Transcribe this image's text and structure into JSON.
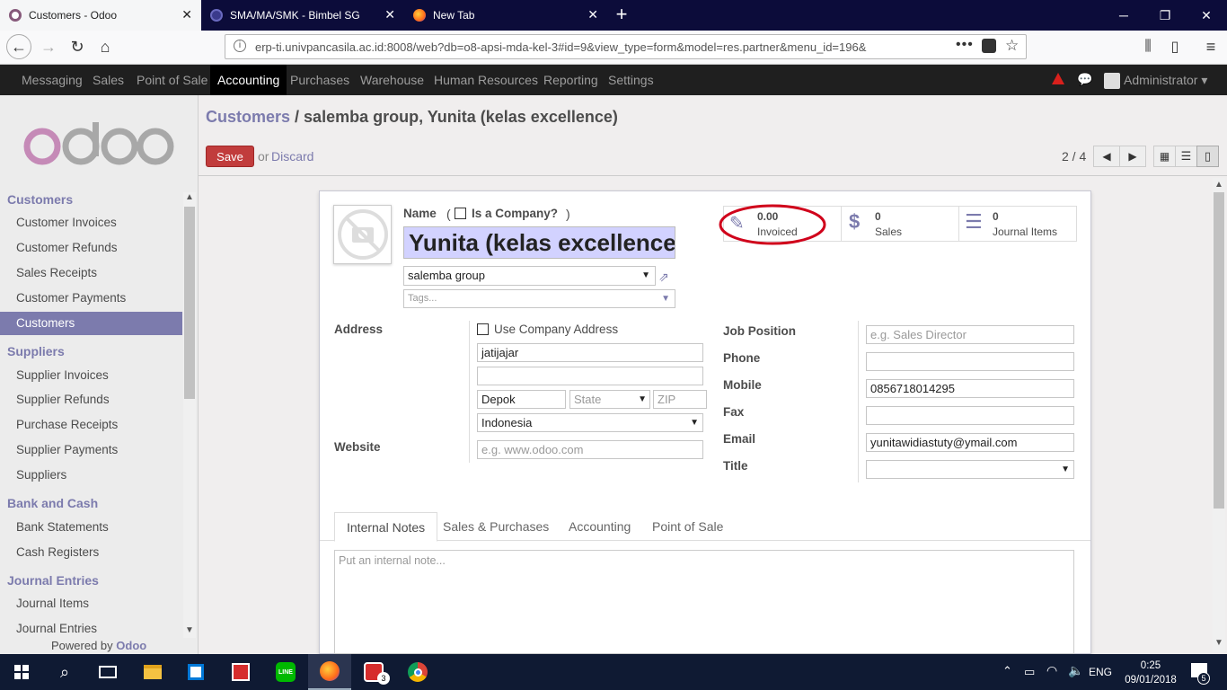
{
  "browser": {
    "tabs": [
      {
        "title": "Customers - Odoo"
      },
      {
        "title": "SMA/MA/SMK - Bimbel SG"
      },
      {
        "title": "New Tab"
      }
    ],
    "url": "erp-ti.univpancasila.ac.id:8008/web?db=o8-apsi-mda-kel-3#id=9&view_type=form&model=res.partner&menu_id=196&"
  },
  "topmenu": {
    "items": [
      "Messaging",
      "Sales",
      "Point of Sale",
      "Accounting",
      "Purchases",
      "Warehouse",
      "Human Resources",
      "Reporting",
      "Settings"
    ],
    "active": "Accounting",
    "user": "Administrator"
  },
  "sidebar": {
    "logo": "odoo",
    "sections": [
      {
        "title": "Customers",
        "items": [
          "Customer Invoices",
          "Customer Refunds",
          "Sales Receipts",
          "Customer Payments",
          "Customers"
        ]
      },
      {
        "title": "Suppliers",
        "items": [
          "Supplier Invoices",
          "Supplier Refunds",
          "Purchase Receipts",
          "Supplier Payments",
          "Suppliers"
        ]
      },
      {
        "title": "Bank and Cash",
        "items": [
          "Bank Statements",
          "Cash Registers"
        ]
      },
      {
        "title": "Journal Entries",
        "items": [
          "Journal Items",
          "Journal Entries"
        ]
      }
    ],
    "selected": "Customers",
    "footer_prefix": "Powered by ",
    "footer_brand": "Odoo"
  },
  "header": {
    "breadcrumb_parent": "Customers",
    "breadcrumb_sep": " / ",
    "breadcrumb_current": "salemba group, Yunita (kelas excellence)",
    "save_label": "Save",
    "or_label": "or",
    "discard_label": "Discard",
    "pager": "2 / 4"
  },
  "form": {
    "name_label": "Name",
    "is_company_label": "Is a Company?",
    "paren_open": "(",
    "paren_close": ")",
    "name_value": "Yunita (kelas excellence",
    "parent_company": "salemba group",
    "tags_placeholder": "Tags...",
    "stat_buttons": [
      {
        "value": "0.00",
        "label": "Invoiced"
      },
      {
        "value": "0",
        "label": "Sales"
      },
      {
        "value": "0",
        "label": "Journal Items"
      }
    ],
    "address_label": "Address",
    "use_company_address": "Use Company Address",
    "street": "jatijajar",
    "street2": "",
    "city": "Depok",
    "state_placeholder": "State",
    "zip_placeholder": "ZIP",
    "country": "Indonesia",
    "website_label": "Website",
    "website_placeholder": "e.g. www.odoo.com",
    "job_position_label": "Job Position",
    "job_position_placeholder": "e.g. Sales Director",
    "phone_label": "Phone",
    "phone": "",
    "mobile_label": "Mobile",
    "mobile": "0856718014295",
    "fax_label": "Fax",
    "fax": "",
    "email_label": "Email",
    "email": "yunitawidiastuty@ymail.com",
    "title_label": "Title",
    "title": "",
    "notebook_tabs": [
      "Internal Notes",
      "Sales & Purchases",
      "Accounting",
      "Point of Sale"
    ],
    "active_tab": "Internal Notes",
    "note_placeholder": "Put an internal note..."
  },
  "taskbar": {
    "language": "ENG",
    "time": "0:25",
    "date": "09/01/2018",
    "notifications": "5",
    "instagram_badge": "3"
  },
  "colors": {
    "accent": "#7c7bad",
    "save": "#c13c3c",
    "annotation": "#d0021b"
  }
}
